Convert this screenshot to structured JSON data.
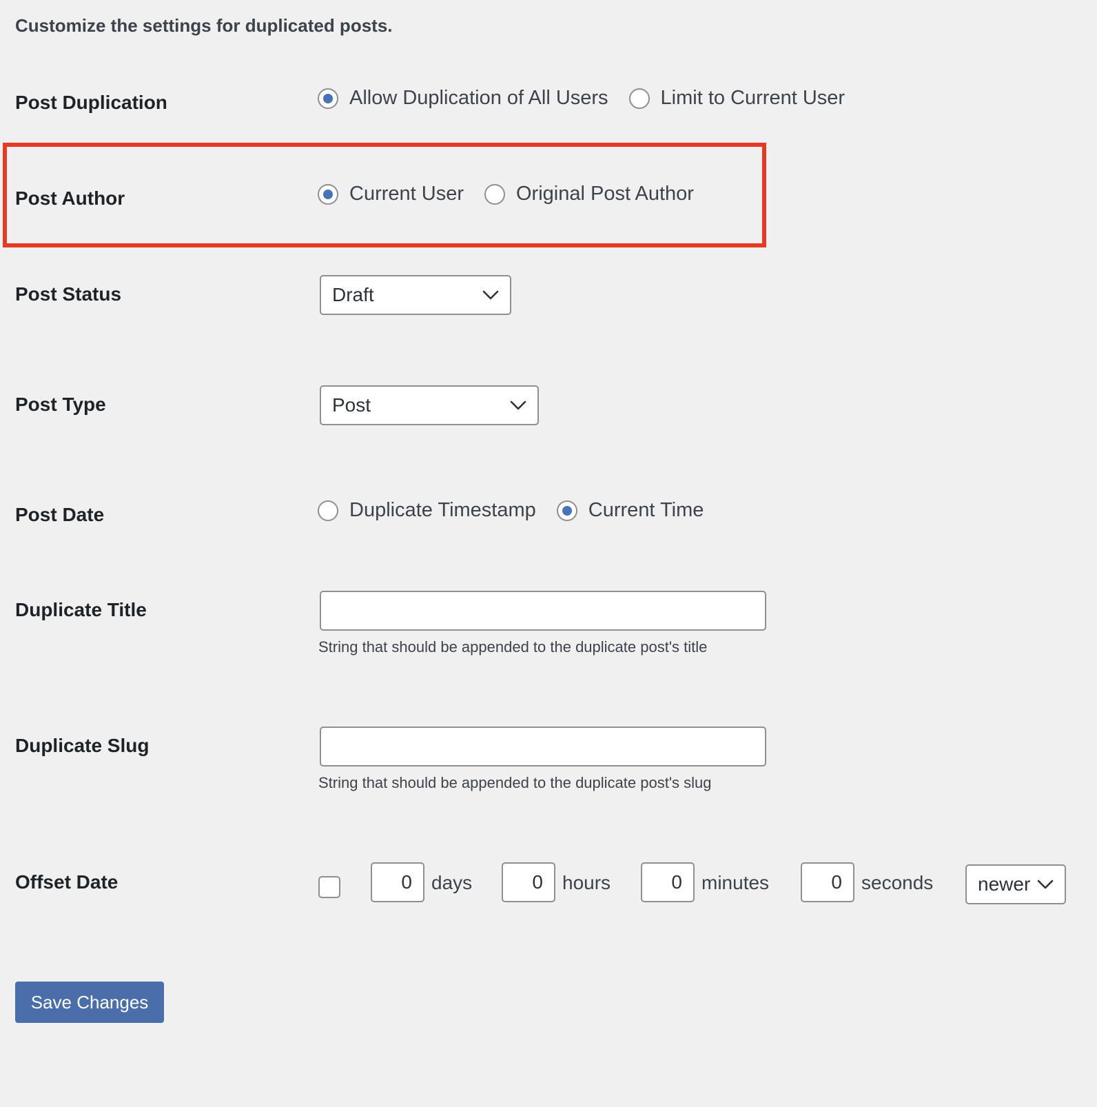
{
  "intro": "Customize the settings for duplicated posts.",
  "post_duplication": {
    "label": "Post Duplication",
    "options": [
      {
        "label": "Allow Duplication of All Users",
        "checked": true
      },
      {
        "label": "Limit to Current User",
        "checked": false
      }
    ]
  },
  "post_author": {
    "label": "Post Author",
    "options": [
      {
        "label": "Current User",
        "checked": true
      },
      {
        "label": "Original Post Author",
        "checked": false
      }
    ]
  },
  "post_status": {
    "label": "Post Status",
    "selected": "Draft"
  },
  "post_type": {
    "label": "Post Type",
    "selected": "Post"
  },
  "post_date": {
    "label": "Post Date",
    "options": [
      {
        "label": "Duplicate Timestamp",
        "checked": false
      },
      {
        "label": "Current Time",
        "checked": true
      }
    ]
  },
  "duplicate_title": {
    "label": "Duplicate Title",
    "value": "",
    "help": "String that should be appended to the duplicate post's title"
  },
  "duplicate_slug": {
    "label": "Duplicate Slug",
    "value": "",
    "help": "String that should be appended to the duplicate post's slug"
  },
  "offset_date": {
    "label": "Offset Date",
    "enabled": false,
    "days": {
      "value": "0",
      "unit": "days"
    },
    "hours": {
      "value": "0",
      "unit": "hours"
    },
    "minutes": {
      "value": "0",
      "unit": "minutes"
    },
    "seconds": {
      "value": "0",
      "unit": "seconds"
    },
    "direction": "newer"
  },
  "save_label": "Save Changes",
  "colors": {
    "background": "#f0f0f1",
    "accent": "#4a72b8",
    "button": "#4a6ea9",
    "highlight": "#e53a24"
  }
}
